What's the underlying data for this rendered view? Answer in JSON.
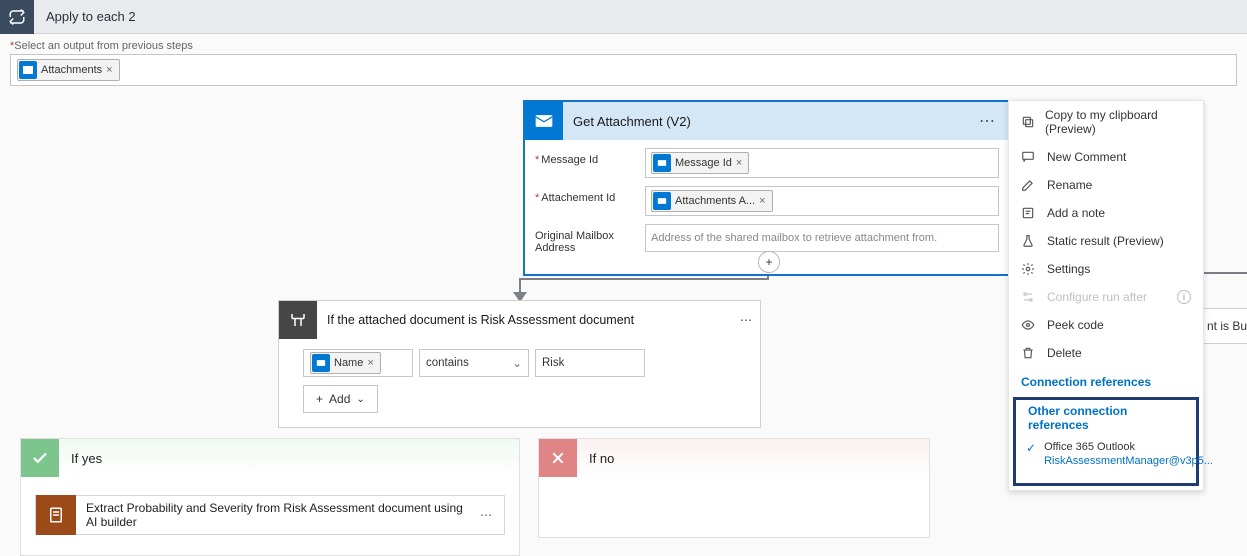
{
  "top": {
    "title": "Apply to each 2"
  },
  "output": {
    "label": "Select an output from previous steps",
    "token": "Attachments"
  },
  "attachmentCard": {
    "title": "Get Attachment (V2)",
    "fields": {
      "messageId": {
        "label": "Message Id",
        "token": "Message Id"
      },
      "attachmentId": {
        "label": "Attachement Id",
        "token": "Attachments A..."
      },
      "mailbox": {
        "label1": "Original Mailbox",
        "label2": "Address",
        "placeholder": "Address of the shared mailbox to retrieve attachment from."
      }
    }
  },
  "condition": {
    "title": "If the attached document is Risk Assessment document",
    "row": {
      "leftToken": "Name",
      "operator": "contains",
      "right": "Risk"
    },
    "addLabel": "Add"
  },
  "branches": {
    "yes": {
      "label": "If yes",
      "action": "Extract Probability and Severity from Risk Assessment document using AI builder"
    },
    "no": {
      "label": "If no"
    }
  },
  "partial": {
    "text": "nt is Busine"
  },
  "menu": {
    "items": [
      {
        "icon": "copy",
        "label": "Copy to my clipboard (Preview)"
      },
      {
        "icon": "comment",
        "label": "New Comment"
      },
      {
        "icon": "edit",
        "label": "Rename"
      },
      {
        "icon": "note",
        "label": "Add a note"
      },
      {
        "icon": "flask",
        "label": "Static result (Preview)"
      },
      {
        "icon": "gear",
        "label": "Settings"
      },
      {
        "icon": "config",
        "label": "Configure run after",
        "disabled": true,
        "info": true
      },
      {
        "icon": "eye",
        "label": "Peek code"
      },
      {
        "icon": "trash",
        "label": "Delete"
      }
    ],
    "section1": "Connection references",
    "section2": "Other connection references",
    "conn": {
      "name": "Office 365 Outlook",
      "email": "RiskAssessmentManager@v3p5..."
    }
  }
}
